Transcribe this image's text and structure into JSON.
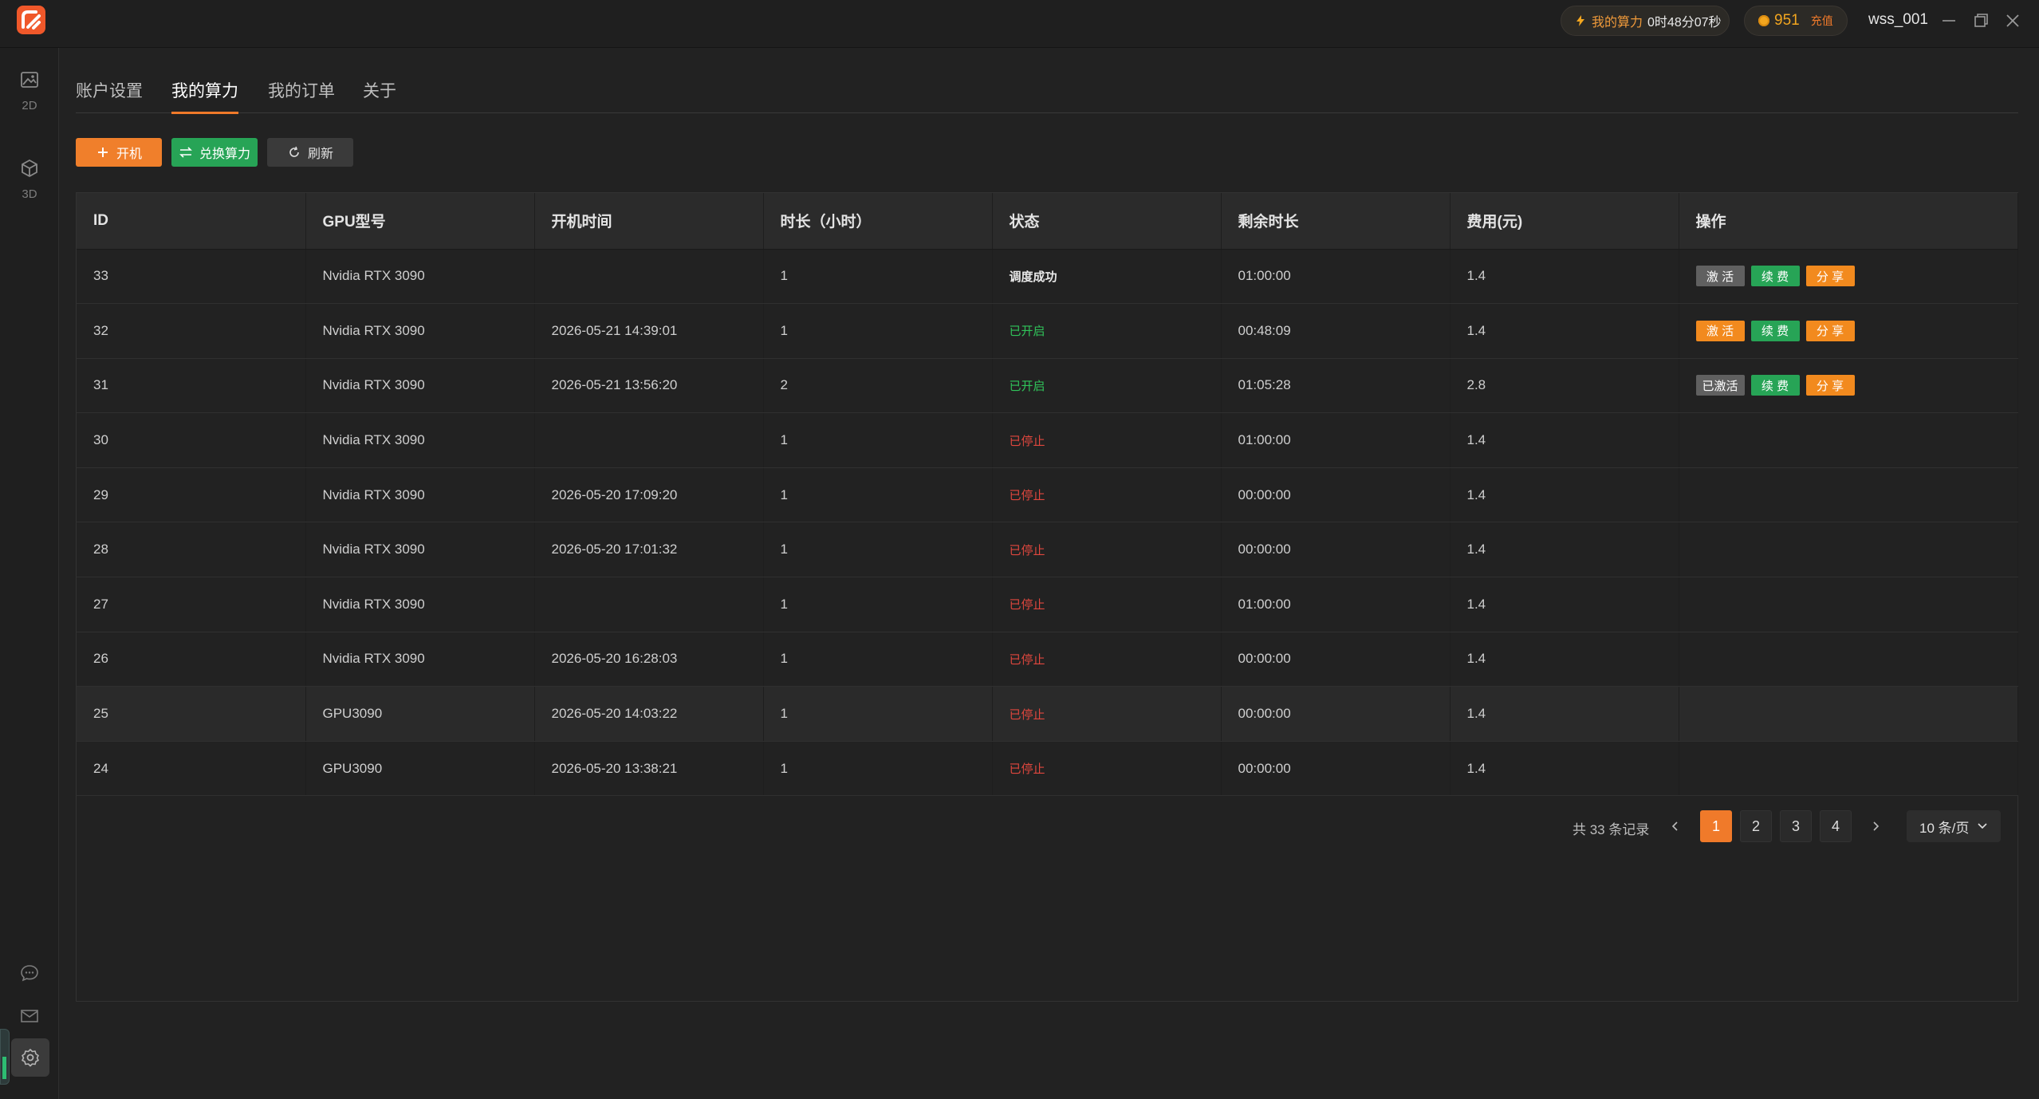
{
  "header": {
    "power_label": "我的算力",
    "power_time": "0时48分07秒",
    "coins": "951",
    "recharge_label": "充值",
    "username": "wss_001"
  },
  "sidebar": {
    "items": [
      {
        "label": "2D",
        "icon": "image-icon"
      },
      {
        "label": "3D",
        "icon": "cube-icon"
      }
    ],
    "bottom_icons": [
      "chat-icon",
      "mail-icon",
      "settings-icon"
    ]
  },
  "tabs": [
    {
      "label": "账户设置",
      "active": false
    },
    {
      "label": "我的算力",
      "active": true
    },
    {
      "label": "我的订单",
      "active": false
    },
    {
      "label": "关于",
      "active": false
    }
  ],
  "toolbar": {
    "start_label": "开机",
    "exchange_label": "兑换算力",
    "refresh_label": "刷新"
  },
  "table": {
    "columns": [
      "ID",
      "GPU型号",
      "开机时间",
      "时长（小时）",
      "状态",
      "剩余时长",
      "费用(元)",
      "操作"
    ],
    "rows": [
      {
        "id": "33",
        "gpu": "Nvidia RTX 3090",
        "start": "",
        "hours": "1",
        "status": "调度成功",
        "status_type": "ok",
        "remaining": "01:00:00",
        "fee": "1.4",
        "actions": [
          {
            "label": "激 活",
            "color": "gray"
          },
          {
            "label": "续 费",
            "color": "green"
          },
          {
            "label": "分 享",
            "color": "orange"
          }
        ]
      },
      {
        "id": "32",
        "gpu": "Nvidia RTX 3090",
        "start": "2026-05-21 14:39:01",
        "hours": "1",
        "status": "已开启",
        "status_type": "on",
        "remaining": "00:48:09",
        "fee": "1.4",
        "actions": [
          {
            "label": "激 活",
            "color": "orange"
          },
          {
            "label": "续 费",
            "color": "green"
          },
          {
            "label": "分 享",
            "color": "orange"
          }
        ]
      },
      {
        "id": "31",
        "gpu": "Nvidia RTX 3090",
        "start": "2026-05-21 13:56:20",
        "hours": "2",
        "status": "已开启",
        "status_type": "on",
        "remaining": "01:05:28",
        "fee": "2.8",
        "actions": [
          {
            "label": "已激活",
            "color": "gray"
          },
          {
            "label": "续 费",
            "color": "green"
          },
          {
            "label": "分 享",
            "color": "orange"
          }
        ]
      },
      {
        "id": "30",
        "gpu": "Nvidia RTX 3090",
        "start": "",
        "hours": "1",
        "status": "已停止",
        "status_type": "off",
        "remaining": "01:00:00",
        "fee": "1.4",
        "actions": []
      },
      {
        "id": "29",
        "gpu": "Nvidia RTX 3090",
        "start": "2026-05-20 17:09:20",
        "hours": "1",
        "status": "已停止",
        "status_type": "off",
        "remaining": "00:00:00",
        "fee": "1.4",
        "actions": []
      },
      {
        "id": "28",
        "gpu": "Nvidia RTX 3090",
        "start": "2026-05-20 17:01:32",
        "hours": "1",
        "status": "已停止",
        "status_type": "off",
        "remaining": "00:00:00",
        "fee": "1.4",
        "actions": []
      },
      {
        "id": "27",
        "gpu": "Nvidia RTX 3090",
        "start": "",
        "hours": "1",
        "status": "已停止",
        "status_type": "off",
        "remaining": "01:00:00",
        "fee": "1.4",
        "actions": []
      },
      {
        "id": "26",
        "gpu": "Nvidia RTX 3090",
        "start": "2026-05-20 16:28:03",
        "hours": "1",
        "status": "已停止",
        "status_type": "off",
        "remaining": "00:00:00",
        "fee": "1.4",
        "actions": []
      },
      {
        "id": "25",
        "gpu": "GPU3090",
        "start": "2026-05-20 14:03:22",
        "hours": "1",
        "status": "已停止",
        "status_type": "off",
        "remaining": "00:00:00",
        "fee": "1.4",
        "actions": [],
        "highlighted": true
      },
      {
        "id": "24",
        "gpu": "GPU3090",
        "start": "2026-05-20 13:38:21",
        "hours": "1",
        "status": "已停止",
        "status_type": "off",
        "remaining": "00:00:00",
        "fee": "1.4",
        "actions": []
      }
    ]
  },
  "pagination": {
    "total_text": "共 33 条记录",
    "pages": [
      "1",
      "2",
      "3",
      "4"
    ],
    "current": "1",
    "page_size": "10 条/页"
  },
  "colors": {
    "accent": "#f07a2a",
    "green": "#27a456",
    "status_on": "#30c45a",
    "status_off": "#e0473e"
  }
}
